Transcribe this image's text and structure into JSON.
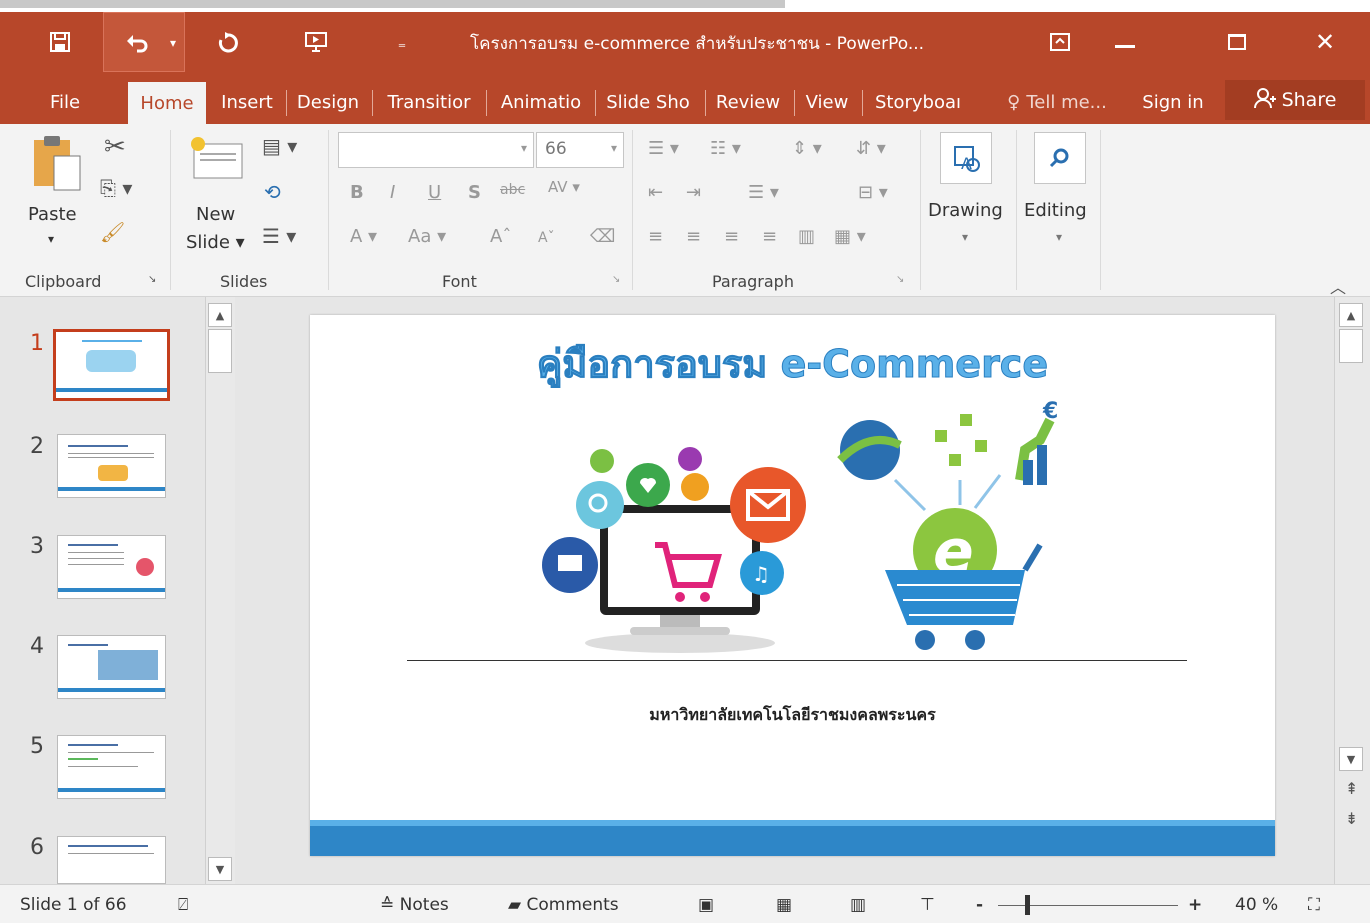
{
  "app": {
    "title": "โครงการอบรม e-commerce สำหรับประชาชน - PowerPo...",
    "accent": "#b7472a"
  },
  "quick_access": {
    "save_icon": "save-icon",
    "undo_icon": "undo-icon",
    "redo_icon": "redo-icon",
    "present_icon": "present-from-start-icon",
    "customize_icon": "customize-qat-icon"
  },
  "window_controls": {
    "ribbon_display_icon": "ribbon-display-icon",
    "minimize_icon": "minimize-icon",
    "maximize_icon": "maximize-icon",
    "close_icon": "close-icon"
  },
  "tabs": [
    {
      "label": "File"
    },
    {
      "label": "Home"
    },
    {
      "label": "Insert"
    },
    {
      "label": "Design"
    },
    {
      "label": "Transitior"
    },
    {
      "label": "Animatio"
    },
    {
      "label": "Slide Sho"
    },
    {
      "label": "Review"
    },
    {
      "label": "View"
    },
    {
      "label": "Storyboaı"
    }
  ],
  "tell_me": "Tell me...",
  "sign_in": "Sign in",
  "share": "Share",
  "ribbon": {
    "clipboard": {
      "label": "Clipboard",
      "paste": "Paste"
    },
    "slides": {
      "label": "Slides",
      "new_slide_line1": "New",
      "new_slide_line2": "Slide"
    },
    "font": {
      "label": "Font",
      "font_name": "",
      "font_size": "66"
    },
    "paragraph": {
      "label": "Paragraph"
    },
    "drawing": {
      "label": "Drawing"
    },
    "editing": {
      "label": "Editing"
    }
  },
  "thumbnails": [
    "1",
    "2",
    "3",
    "4",
    "5",
    "6"
  ],
  "slide": {
    "title": "คู่มือการอบรม e-Commerce",
    "subtitle": "มหาวิทยาลัยเทคโนโลยีราชมงคลพระนคร"
  },
  "status": {
    "slide_info": "Slide 1 of 66",
    "notes": "Notes",
    "comments": "Comments",
    "zoom_minus": "-",
    "zoom_plus": "+",
    "zoom": "40 %"
  }
}
